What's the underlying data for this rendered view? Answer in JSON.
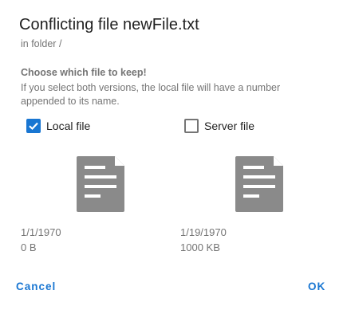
{
  "dialog": {
    "title": "Conflicting file newFile.txt",
    "subtitle": "in folder /",
    "heading": "Choose which file to keep!",
    "description": "If you select both versions, the local file will have a number appended to its name."
  },
  "options": {
    "local": {
      "label": "Local file",
      "checked": true,
      "date": "1/1/1970",
      "size": "0 B",
      "icon": "file-document-icon"
    },
    "server": {
      "label": "Server file",
      "checked": false,
      "date": "1/19/1970",
      "size": "1000 KB",
      "icon": "file-document-icon"
    }
  },
  "buttons": {
    "cancel": "Cancel",
    "ok": "OK"
  },
  "colors": {
    "accent": "#1976D2",
    "icon": "#8a8a8a",
    "secondary_text": "#757575",
    "primary_text": "#212121"
  }
}
